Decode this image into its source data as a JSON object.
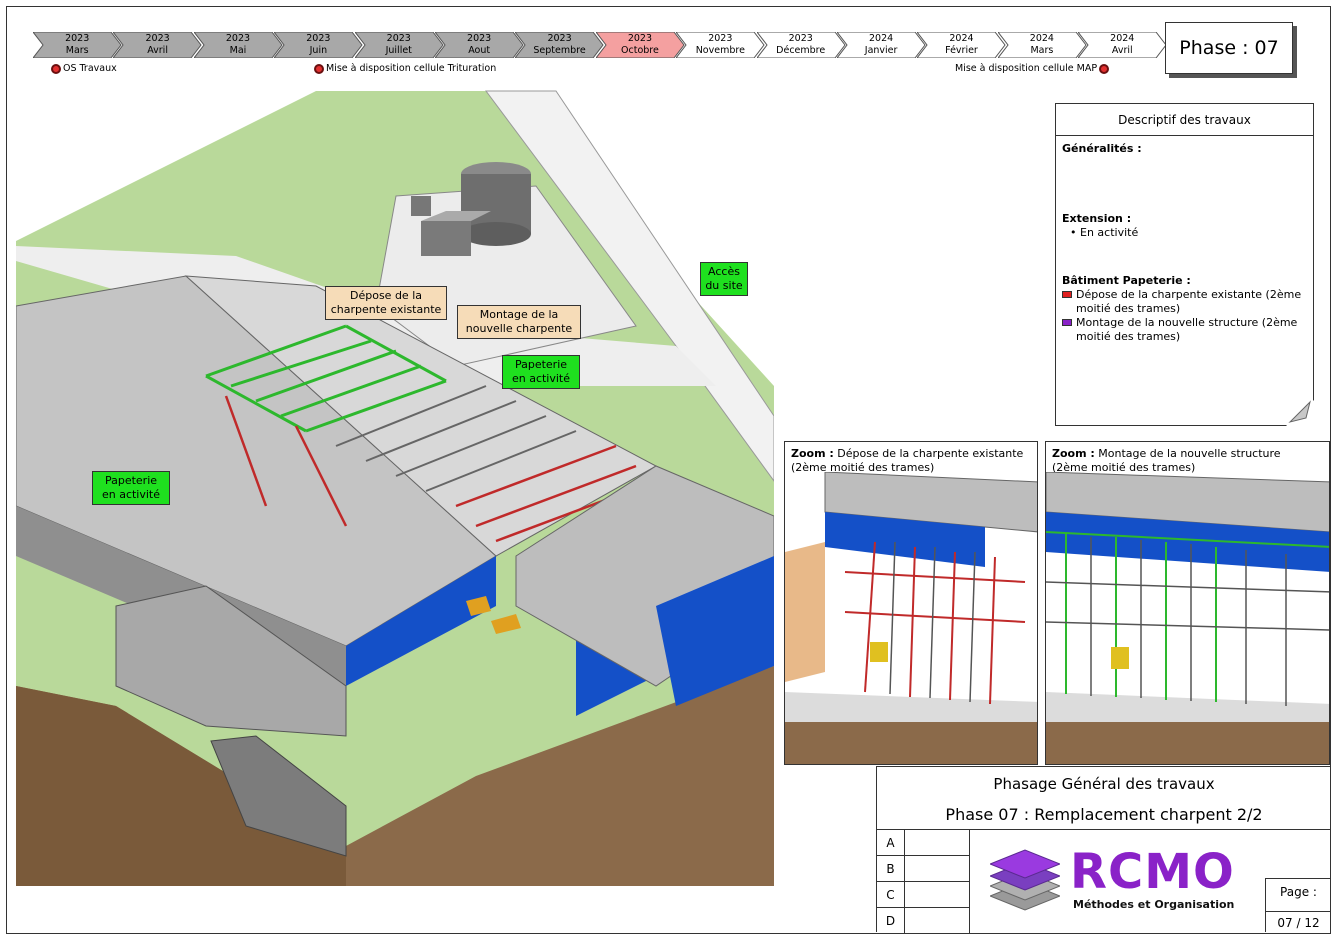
{
  "timeline": {
    "segments": [
      {
        "year": "2023",
        "month": "Mars",
        "highlight": false
      },
      {
        "year": "2023",
        "month": "Avril",
        "highlight": false
      },
      {
        "year": "2023",
        "month": "Mai",
        "highlight": false
      },
      {
        "year": "2023",
        "month": "Juin",
        "highlight": false
      },
      {
        "year": "2023",
        "month": "Juillet",
        "highlight": false
      },
      {
        "year": "2023",
        "month": "Aout",
        "highlight": false
      },
      {
        "year": "2023",
        "month": "Septembre",
        "highlight": false
      },
      {
        "year": "2023",
        "month": "Octobre",
        "highlight": true
      },
      {
        "year": "2023",
        "month": "Novembre",
        "highlight": false
      },
      {
        "year": "2023",
        "month": "Décembre",
        "highlight": false
      },
      {
        "year": "2024",
        "month": "Janvier",
        "highlight": false
      },
      {
        "year": "2024",
        "month": "Février",
        "highlight": false
      },
      {
        "year": "2024",
        "month": "Mars",
        "highlight": false
      },
      {
        "year": "2024",
        "month": "Avril",
        "highlight": false
      }
    ],
    "milestones": {
      "os": "OS Travaux",
      "trituration": "Mise à disposition cellule Trituration",
      "map": "Mise à disposition cellule MAP"
    },
    "colors": {
      "past": "#a8a8a8",
      "current": "#f4a0a0",
      "future": "#ffffff"
    }
  },
  "phase_label": "Phase : 07",
  "scene": {
    "callouts": {
      "depose": "Dépose de la charpente existante",
      "montage": "Montage de la nouvelle charpente",
      "acces": "Accès du site",
      "papeterie_right": "Papeterie en activité",
      "papeterie_left": "Papeterie en activité"
    }
  },
  "description": {
    "header": "Descriptif des travaux",
    "generalites": "Généralités :",
    "extension": "Extension :",
    "extension_item": "En activité",
    "batiment": "Bâtiment Papeterie :",
    "legend": [
      {
        "color": "#e02020",
        "text": "Dépose de la charpente existante (2ème moitié des trames)"
      },
      {
        "color": "#8a22c8",
        "text": "Montage de la nouvelle structure (2ème moitié des trames)"
      }
    ]
  },
  "zoom_left": {
    "label": "Zoom :",
    "text": "Dépose de la charpente existante (2ème moitié des trames)"
  },
  "zoom_right": {
    "label": "Zoom :",
    "text": "Montage de la nouvelle structure (2ème moitié des trames)"
  },
  "title_block": {
    "title1": "Phasage Général des travaux",
    "title2": "Phase 07 : Remplacement charpent 2/2",
    "revisions": [
      "A",
      "B",
      "C",
      "D"
    ],
    "logo": "RCMO",
    "logo_sub": "Méthodes et Organisation",
    "page_label": "Page :",
    "page_number": "07 / 12"
  }
}
